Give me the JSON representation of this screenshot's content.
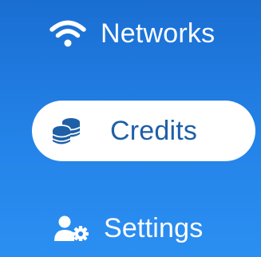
{
  "nav": {
    "items": [
      {
        "label": "Networks",
        "icon": "wifi-icon",
        "active": false
      },
      {
        "label": "Credits",
        "icon": "coins-icon",
        "active": true
      },
      {
        "label": "Settings",
        "icon": "user-gear-icon",
        "active": false
      }
    ]
  },
  "colors": {
    "background_top": "#1a6ed2",
    "background_bottom": "#2b8ff2",
    "active_pill": "#ffffff",
    "active_text": "#1e5fa7",
    "inactive_text": "#ffffff"
  }
}
